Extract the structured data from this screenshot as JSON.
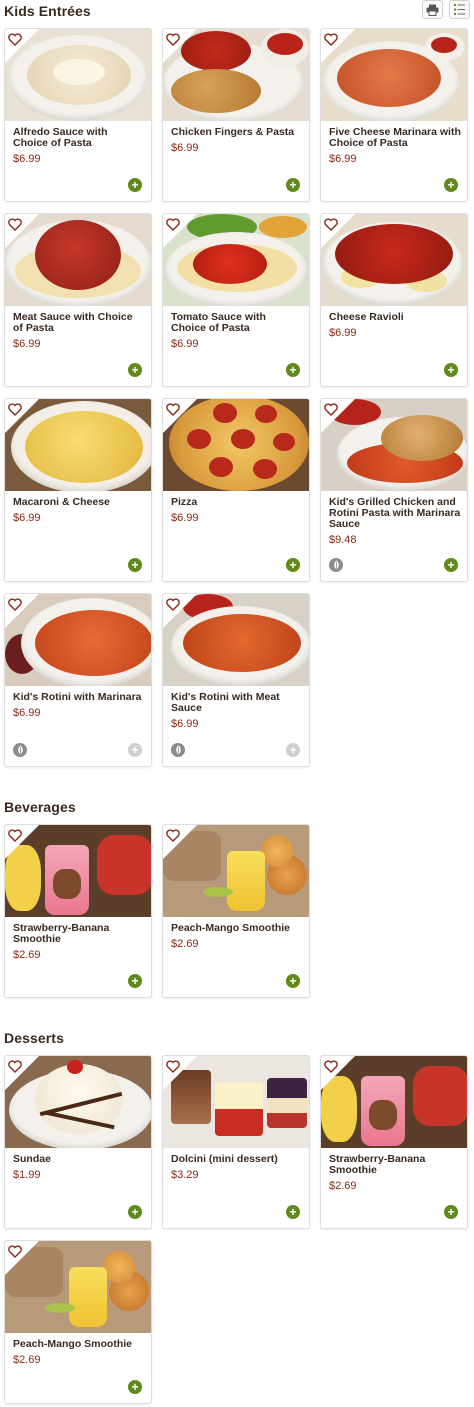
{
  "toolbar": {
    "print_icon": "printer-icon",
    "list_icon": "list-view-icon"
  },
  "sections": {
    "kids": {
      "title": "Kids Entrées",
      "items": [
        {
          "name": "Alfredo Sauce with Choice of Pasta",
          "price": "$6.99"
        },
        {
          "name": "Chicken Fingers & Pasta",
          "price": "$6.99"
        },
        {
          "name": "Five Cheese Marinara with Choice of Pasta",
          "price": "$6.99"
        },
        {
          "name": "Meat Sauce with Choice of Pasta",
          "price": "$6.99"
        },
        {
          "name": "Tomato Sauce with Choice of Pasta",
          "price": "$6.99"
        },
        {
          "name": "Cheese Ravioli",
          "price": "$6.99"
        },
        {
          "name": "Macaroni & Cheese",
          "price": "$6.99"
        },
        {
          "name": "Pizza",
          "price": "$6.99"
        },
        {
          "name": "Kid's Grilled Chicken and Rotini Pasta with Marinara Sauce",
          "price": "$9.48"
        },
        {
          "name": "Kid's Rotini with Marinara",
          "price": "$6.99"
        },
        {
          "name": "Kid's Rotini with Meat Sauce",
          "price": "$6.99"
        }
      ]
    },
    "beverages": {
      "title": "Beverages",
      "items": [
        {
          "name": "Strawberry-Banana Smoothie",
          "price": "$2.69"
        },
        {
          "name": "Peach-Mango Smoothie",
          "price": "$2.69"
        }
      ]
    },
    "desserts": {
      "title": "Desserts",
      "items": [
        {
          "name": "Sundae",
          "price": "$1.99"
        },
        {
          "name": "Dolcini (mini dessert)",
          "price": "$3.29"
        },
        {
          "name": "Strawberry-Banana Smoothie",
          "price": "$2.69"
        },
        {
          "name": "Peach-Mango Smoothie",
          "price": "$2.69"
        }
      ]
    }
  },
  "colors": {
    "price": "#8a2a16",
    "add_button": "#5f8a1b",
    "heart": "#8a2a16"
  }
}
